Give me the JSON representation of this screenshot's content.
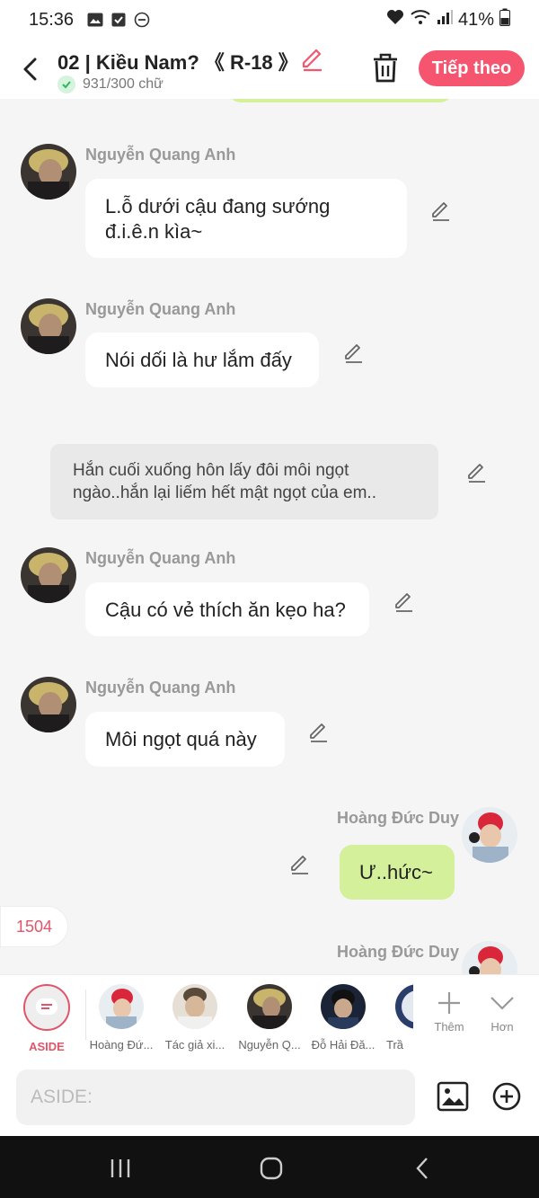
{
  "status_bar": {
    "time": "15:36",
    "battery": "41%",
    "left_icons": [
      "gallery-icon",
      "checkbox-icon",
      "dnd-icon"
    ],
    "right_icons": [
      "heart-icon",
      "wifi-icon",
      "signal-icon",
      "battery-icon"
    ]
  },
  "header": {
    "title": "02 | Kiều Nam? 《 R-18 》",
    "word_count": "931/300 chữ",
    "next_label": "Tiếp theo",
    "accent_color": "#f5556e"
  },
  "messages": [
    {
      "type": "character",
      "sender": "Nguyễn Quang Anh",
      "lines": [
        "L.ỗ dưới cậu đang sướng",
        "đ.i.ê.n kìa~"
      ]
    },
    {
      "type": "character",
      "sender": "Nguyễn Quang Anh",
      "text": "Nói dối là hư lắm đấy"
    },
    {
      "type": "narration",
      "lines": [
        "Hắn cuối xuống hôn lấy đôi môi ngọt",
        "ngào..hắn lại liếm hết mật ngọt của em.."
      ]
    },
    {
      "type": "character",
      "sender": "Nguyễn Quang Anh",
      "text": "Cậu có vẻ thích ăn kẹo ha?"
    },
    {
      "type": "character",
      "sender": "Nguyễn Quang Anh",
      "text": "Môi ngọt quá này"
    },
    {
      "type": "self",
      "sender": "Hoàng Đức Duy",
      "text": "Ư..hức~"
    },
    {
      "type": "self",
      "sender": "Hoàng Đức Duy",
      "text": ""
    }
  ],
  "badge": "1504",
  "characters": [
    {
      "name": "ASIDE",
      "active": true
    },
    {
      "name": "Hoàng Đứ..."
    },
    {
      "name": "Tác giả xi..."
    },
    {
      "name": "Nguyễn Q..."
    },
    {
      "name": "Đỗ Hải Đă..."
    },
    {
      "name": "Trầ"
    }
  ],
  "utils": {
    "add_label": "Thêm",
    "more_label": "Hơn"
  },
  "input": {
    "placeholder": "ASIDE:"
  }
}
